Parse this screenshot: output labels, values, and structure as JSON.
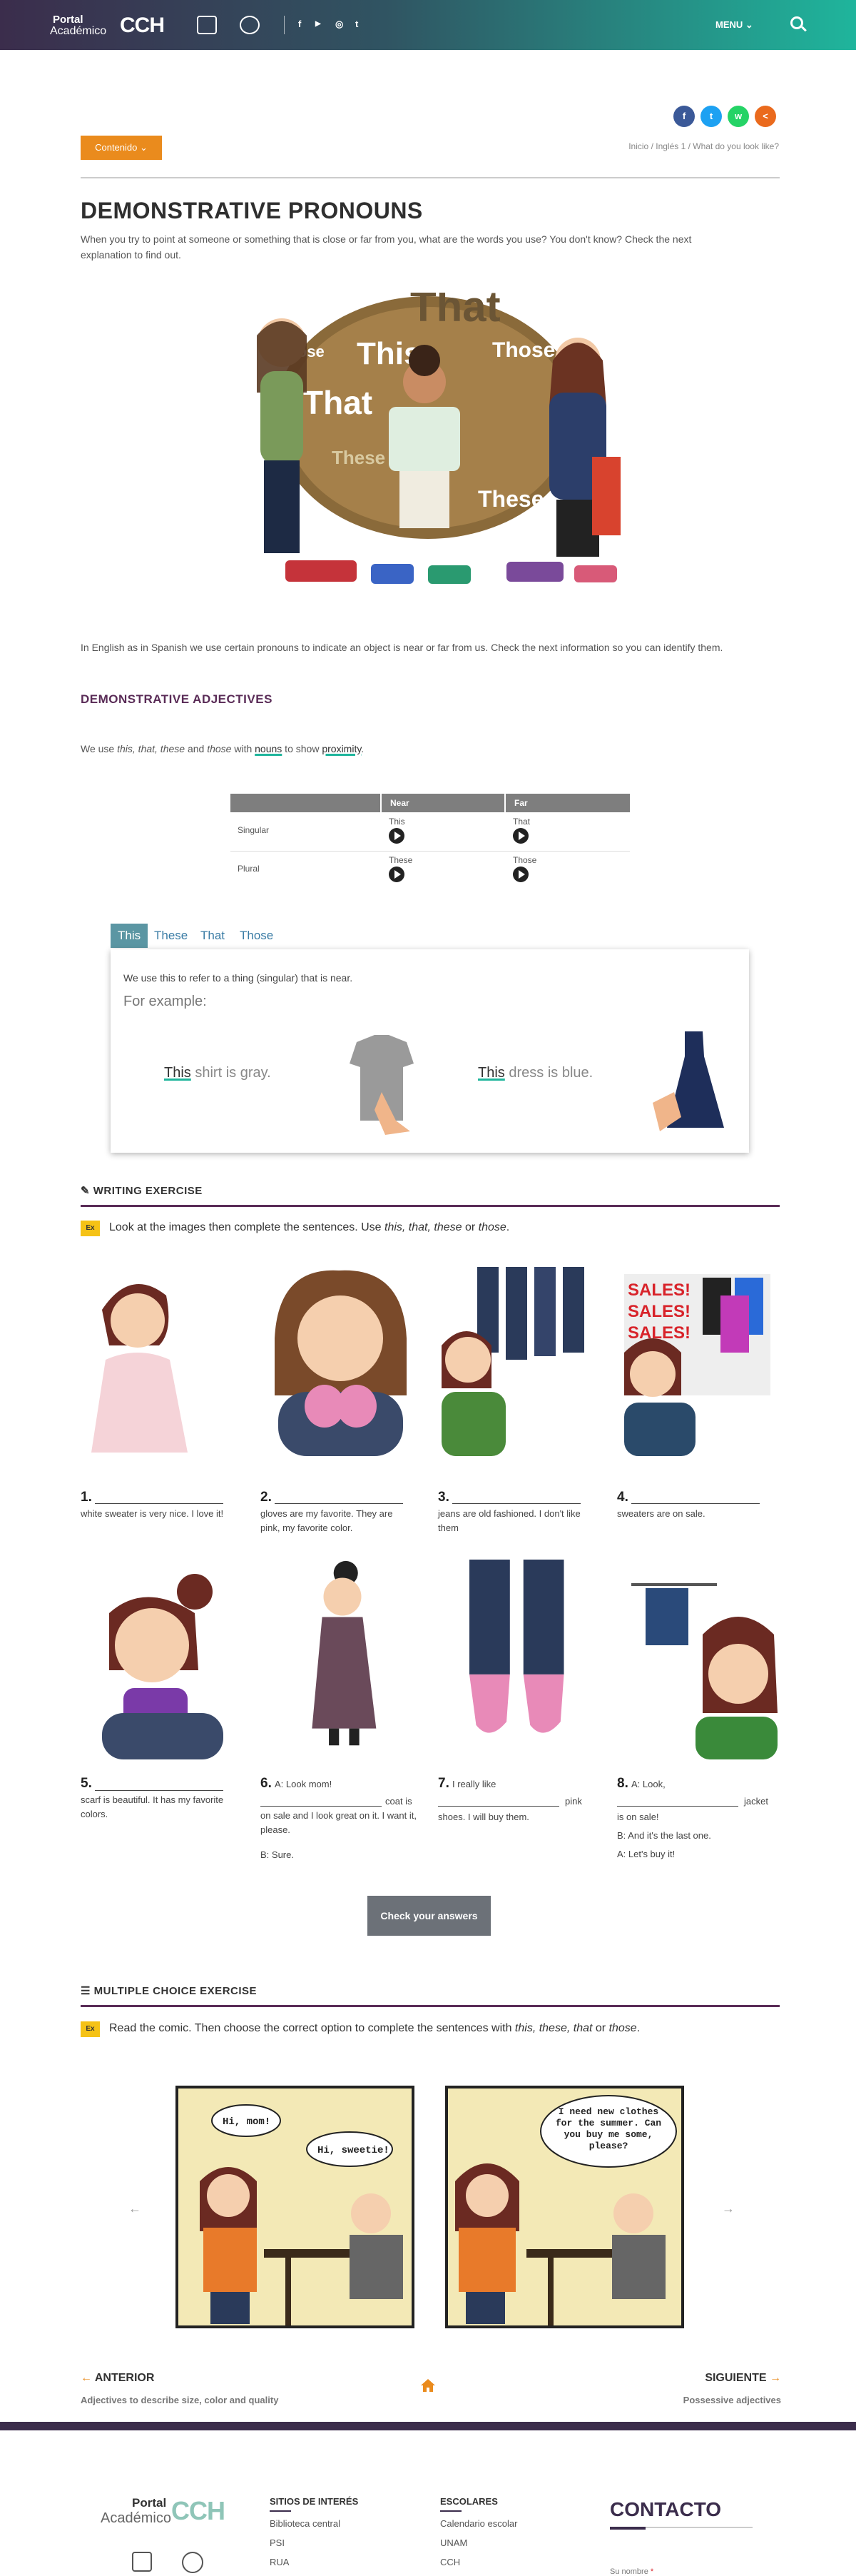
{
  "header": {
    "logo_portal": "Portal",
    "logo_academico": "Académico",
    "logo_cch": "CCH",
    "menu_label": "MENU",
    "social": [
      "f",
      "▶",
      "◎",
      "t"
    ]
  },
  "share": {
    "colors": [
      "#3b5998",
      "#1da1f2",
      "#25d366",
      "#ea6a1d"
    ]
  },
  "contenido_label": "Contenido",
  "breadcrumb": "Inicio / Inglés 1 / What do you look like?",
  "page_title": "DEMONSTRATIVE PRONOUNS",
  "intro": "When you try to point at someone or something that is close or far from you, what are the words you use? You don't know? Check the next explanation to find out.",
  "hero": {
    "words": [
      "That",
      "This",
      "Those",
      "That",
      "These",
      "These",
      "Those"
    ]
  },
  "info_paragraph": "In English as in Spanish we use certain pronouns to indicate an object is near or far from us. Check the next information so you can identify them.",
  "adjectives": {
    "heading": "DEMONSTRATIVE ADJECTIVES",
    "text_before": "We use ",
    "words": "this, that, these",
    "and": " and ",
    "those": "those",
    "with": " with ",
    "nouns": "nouns",
    "to_show": " to show ",
    "proximity": "proximity",
    "period": "."
  },
  "table": {
    "headers": [
      "",
      "Near",
      "Far"
    ],
    "rows": [
      {
        "label": "Singular",
        "near": "This",
        "far": "That"
      },
      {
        "label": "Plural",
        "near": "These",
        "far": "Those"
      }
    ]
  },
  "tabs": {
    "items": [
      "This",
      "These",
      "That",
      "Those"
    ],
    "active": "This",
    "description": "We use this to refer to a thing (singular) that is near.",
    "for_example": "For example:",
    "ex1_word": "This",
    "ex1_rest": " shirt is gray.",
    "ex2_word": "This",
    "ex2_rest": " dress is blue."
  },
  "writing": {
    "heading": "WRITING EXERCISE",
    "badge": "Ex",
    "instruction_a": "Look at the images then complete the sentences. Use ",
    "instruction_words": "this, that, these",
    "instruction_or": " or ",
    "instruction_those": "those",
    "instruction_end": ".",
    "items": [
      {
        "num": "1.",
        "text": "white sweater is very nice. I love it!"
      },
      {
        "num": "2.",
        "text": "gloves are my favorite. They are pink, my favorite color."
      },
      {
        "num": "3.",
        "text": "jeans are old fashioned. I don't like them"
      },
      {
        "num": "4.",
        "text": "sweaters are on sale."
      },
      {
        "num": "5.",
        "text": "scarf is beautiful. It has my favorite colors."
      },
      {
        "num": "6.",
        "pre": "A: Look mom!",
        "mid": "coat is on sale and I look great on it. I want it, please.",
        "post": "B: Sure."
      },
      {
        "num": "7.",
        "pre": "I really like",
        "mid": "pink",
        "post": "shoes. I will buy them."
      },
      {
        "num": "8.",
        "pre": "A: Look,",
        "mid": "jacket",
        "post": "is on sale!",
        "b": "B: And it's the last one.",
        "c": "A: Let's buy it!"
      }
    ],
    "sales_text": "SALES!",
    "check_label": "Check your answers"
  },
  "multiple": {
    "heading": "MULTIPLE CHOICE EXERCISE",
    "badge": "Ex",
    "instruction_a": "Read the comic. Then choose the correct option to complete the sentences with ",
    "instruction_words": "this, these, that",
    "instruction_or": " or ",
    "instruction_those": "those",
    "instruction_end": ".",
    "bubble1": "Hi, mom!",
    "bubble2": "Hi, sweetie!",
    "bubble3": "I need new clothes for the summer. Can you buy me some, please?",
    "arrow_left": "←",
    "arrow_right": "→"
  },
  "pager": {
    "prev_label": "ANTERIOR",
    "prev_sub": "Adjectives to describe size, color and quality",
    "next_label": "SIGUIENTE",
    "next_sub": "Possessive adjectives"
  },
  "footer": {
    "portal": "Portal",
    "academico": "Académico",
    "cch": "CCH",
    "col1_title": "SITIOS DE INTERÉS",
    "col1": [
      "Biblioteca central",
      "PSI",
      "RUA"
    ],
    "col2_title": "ESCOLARES",
    "col2": [
      "Calendario escolar",
      "UNAM",
      "CCH"
    ],
    "contacto": "CONTACTO",
    "su_nombre": "Su nombre"
  }
}
